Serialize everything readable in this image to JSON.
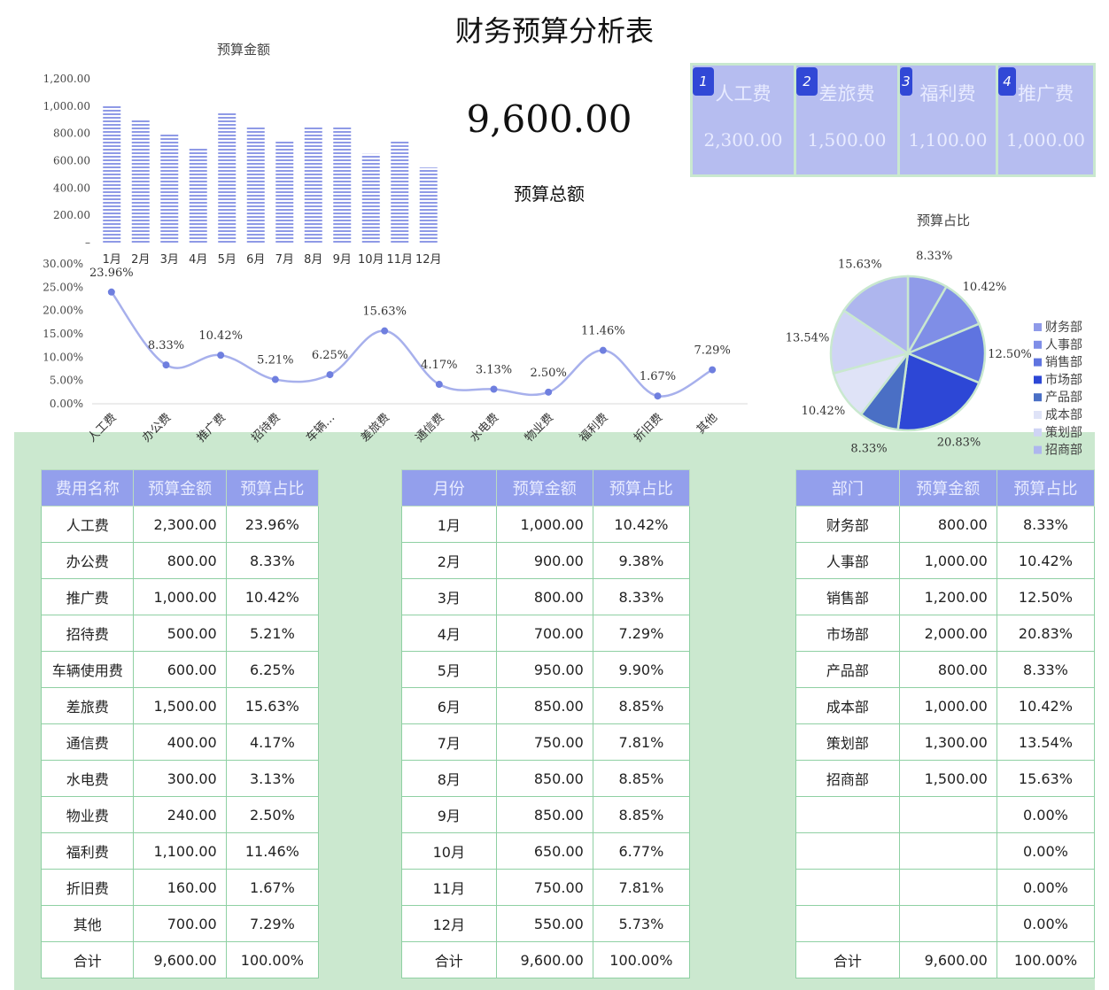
{
  "title": "财务预算分析表",
  "total": {
    "value": "9,600.00",
    "label": "预算总额"
  },
  "kpis": [
    {
      "badge": "1",
      "label": "人工费",
      "value": "2,300.00"
    },
    {
      "badge": "2",
      "label": "差旅费",
      "value": "1,500.00"
    },
    {
      "badge": "3",
      "label": "福利费",
      "value": "1,100.00"
    },
    {
      "badge": "4",
      "label": "推广费",
      "value": "1,000.00"
    }
  ],
  "colors": {
    "bar": "#8f9ae6",
    "line": "#a7b0ec",
    "marker": "#6f7fdf",
    "panel": "#cbe8cf",
    "header": "#939fec",
    "kpi": "#b6bdf0"
  },
  "chart_data": [
    {
      "type": "bar",
      "title": "预算金额",
      "categories": [
        "1月",
        "2月",
        "3月",
        "4月",
        "5月",
        "6月",
        "7月",
        "8月",
        "9月",
        "10月",
        "11月",
        "12月"
      ],
      "values": [
        1000,
        900,
        800,
        700,
        950,
        850,
        750,
        850,
        850,
        650,
        750,
        550
      ],
      "ylim": [
        0,
        1200
      ],
      "yticks": [
        "1,200.00",
        "1,000.00",
        "800.00",
        "600.00",
        "400.00",
        "200.00",
        "–"
      ],
      "ytick_values": [
        1200,
        1000,
        800,
        600,
        400,
        200,
        0
      ]
    },
    {
      "type": "line",
      "categories": [
        "人工费",
        "办公费",
        "推广费",
        "招待费",
        "车辆…",
        "差旅费",
        "通信费",
        "水电费",
        "物业费",
        "福利费",
        "折旧费",
        "其他"
      ],
      "values": [
        23.96,
        8.33,
        10.42,
        5.21,
        6.25,
        15.63,
        4.17,
        3.13,
        2.5,
        11.46,
        1.67,
        7.29
      ],
      "labels": [
        "23.96%",
        "8.33%",
        "10.42%",
        "5.21%",
        "6.25%",
        "15.63%",
        "4.17%",
        "3.13%",
        "2.50%",
        "11.46%",
        "1.67%",
        "7.29%"
      ],
      "ylim": [
        0,
        30
      ],
      "yticks": [
        "30.00%",
        "25.00%",
        "20.00%",
        "15.00%",
        "10.00%",
        "5.00%",
        "0.00%"
      ],
      "ytick_values": [
        30,
        25,
        20,
        15,
        10,
        5,
        0
      ]
    },
    {
      "type": "pie",
      "title": "预算占比",
      "categories": [
        "财务部",
        "人事部",
        "销售部",
        "市场部",
        "产品部",
        "成本部",
        "策划部",
        "招商部"
      ],
      "values": [
        8.33,
        10.42,
        12.5,
        20.83,
        8.33,
        10.42,
        13.54,
        15.63
      ],
      "labels": [
        "8.33%",
        "10.42%",
        "12.50%",
        "20.83%",
        "8.33%",
        "10.42%",
        "13.54%",
        "15.63%"
      ],
      "colors": [
        "#8f9ae9",
        "#7f8ee7",
        "#5f74e0",
        "#2d47d6",
        "#4a6fc5",
        "#dfe3f7",
        "#cfd4f5",
        "#aeb6ee"
      ],
      "legend": "right"
    }
  ],
  "tables": {
    "expense": {
      "headers": [
        "费用名称",
        "预算金额",
        "预算占比"
      ],
      "rows": [
        [
          "人工费",
          "2,300.00",
          "23.96%"
        ],
        [
          "办公费",
          "800.00",
          "8.33%"
        ],
        [
          "推广费",
          "1,000.00",
          "10.42%"
        ],
        [
          "招待费",
          "500.00",
          "5.21%"
        ],
        [
          "车辆使用费",
          "600.00",
          "6.25%"
        ],
        [
          "差旅费",
          "1,500.00",
          "15.63%"
        ],
        [
          "通信费",
          "400.00",
          "4.17%"
        ],
        [
          "水电费",
          "300.00",
          "3.13%"
        ],
        [
          "物业费",
          "240.00",
          "2.50%"
        ],
        [
          "福利费",
          "1,100.00",
          "11.46%"
        ],
        [
          "折旧费",
          "160.00",
          "1.67%"
        ],
        [
          "其他",
          "700.00",
          "7.29%"
        ],
        [
          "合计",
          "9,600.00",
          "100.00%"
        ]
      ]
    },
    "month": {
      "headers": [
        "月份",
        "预算金额",
        "预算占比"
      ],
      "rows": [
        [
          "1月",
          "1,000.00",
          "10.42%"
        ],
        [
          "2月",
          "900.00",
          "9.38%"
        ],
        [
          "3月",
          "800.00",
          "8.33%"
        ],
        [
          "4月",
          "700.00",
          "7.29%"
        ],
        [
          "5月",
          "950.00",
          "9.90%"
        ],
        [
          "6月",
          "850.00",
          "8.85%"
        ],
        [
          "7月",
          "750.00",
          "7.81%"
        ],
        [
          "8月",
          "850.00",
          "8.85%"
        ],
        [
          "9月",
          "850.00",
          "8.85%"
        ],
        [
          "10月",
          "650.00",
          "6.77%"
        ],
        [
          "11月",
          "750.00",
          "7.81%"
        ],
        [
          "12月",
          "550.00",
          "5.73%"
        ],
        [
          "合计",
          "9,600.00",
          "100.00%"
        ]
      ]
    },
    "dept": {
      "headers": [
        "部门",
        "预算金额",
        "预算占比"
      ],
      "rows": [
        [
          "财务部",
          "800.00",
          "8.33%"
        ],
        [
          "人事部",
          "1,000.00",
          "10.42%"
        ],
        [
          "销售部",
          "1,200.00",
          "12.50%"
        ],
        [
          "市场部",
          "2,000.00",
          "20.83%"
        ],
        [
          "产品部",
          "800.00",
          "8.33%"
        ],
        [
          "成本部",
          "1,000.00",
          "10.42%"
        ],
        [
          "策划部",
          "1,300.00",
          "13.54%"
        ],
        [
          "招商部",
          "1,500.00",
          "15.63%"
        ],
        [
          "",
          "",
          "0.00%"
        ],
        [
          "",
          "",
          "0.00%"
        ],
        [
          "",
          "",
          "0.00%"
        ],
        [
          "",
          "",
          "0.00%"
        ],
        [
          "合计",
          "9,600.00",
          "100.00%"
        ]
      ]
    }
  }
}
